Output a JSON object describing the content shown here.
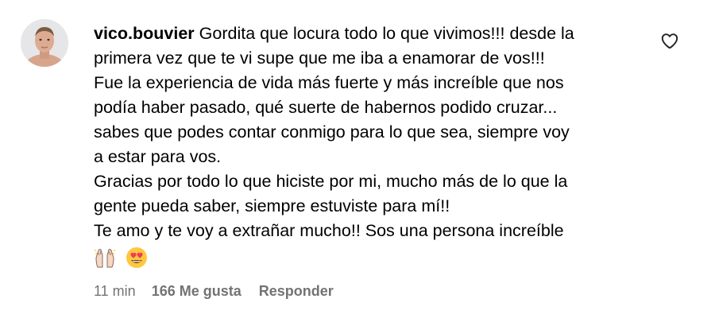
{
  "comment": {
    "username": "vico.bouvier",
    "lines": [
      "Gordita que locura todo lo que vivimos!!! desde la",
      "primera vez que te vi supe que me iba a enamorar de vos!!!",
      "Fue la experiencia de vida más fuerte y más increíble que nos",
      "podía haber pasado, qué suerte de habernos podido cruzar...",
      "sabes que podes contar conmigo para lo que sea, siempre voy",
      "a estar para vos.",
      "Gracias por todo lo que hiciste por mi, mucho más de lo que la",
      "gente pueda saber, siempre estuviste para mí!!",
      "Te amo y te voy a extrañar mucho!! Sos una persona increíble"
    ],
    "emojis": [
      "raising-hands-emoji",
      "heart-eyes-emoji"
    ],
    "time": "11 min",
    "likes": "166 Me gusta",
    "reply_label": "Responder"
  },
  "icons": {
    "like": "heart-outline-icon",
    "avatar": "user-avatar"
  },
  "colors": {
    "text": "#000000",
    "meta": "#737373",
    "emoji_yellow": "#FFC83D",
    "heart_red": "#F4375D"
  }
}
